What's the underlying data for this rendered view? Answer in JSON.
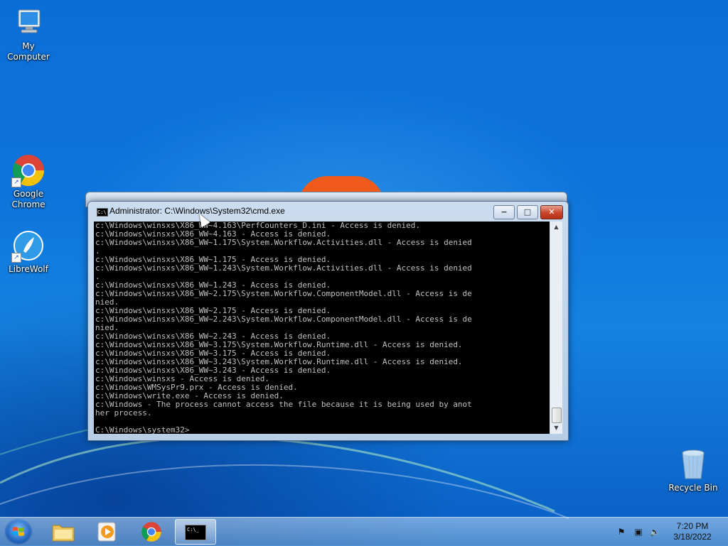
{
  "desktop": {
    "icons": [
      {
        "label": "My Computer"
      },
      {
        "label": "Google\nChrome"
      },
      {
        "label": "LibreWolf"
      },
      {
        "label": "Recycle Bin"
      }
    ]
  },
  "cmd_window": {
    "title": "Administrator: C:\\Windows\\System32\\cmd.exe",
    "buttons": {
      "minimize": "−",
      "maximize": "□",
      "close": "✕"
    },
    "console_lines": [
      "c:\\Windows\\winsxs\\X86_WW~4.163\\PerfCounters_D.ini - Access is denied.",
      "c:\\Windows\\winsxs\\X86_WW~4.163 - Access is denied.",
      "c:\\Windows\\winsxs\\X86_WW~1.175\\System.Workflow.Activities.dll - Access is denied",
      ".",
      "c:\\Windows\\winsxs\\X86_WW~1.175 - Access is denied.",
      "c:\\Windows\\winsxs\\X86_WW~1.243\\System.Workflow.Activities.dll - Access is denied",
      ".",
      "c:\\Windows\\winsxs\\X86_WW~1.243 - Access is denied.",
      "c:\\Windows\\winsxs\\X86_WW~2.175\\System.Workflow.ComponentModel.dll - Access is de",
      "nied.",
      "c:\\Windows\\winsxs\\X86_WW~2.175 - Access is denied.",
      "c:\\Windows\\winsxs\\X86_WW~2.243\\System.Workflow.ComponentModel.dll - Access is de",
      "nied.",
      "c:\\Windows\\winsxs\\X86_WW~2.243 - Access is denied.",
      "c:\\Windows\\winsxs\\X86_WW~3.175\\System.Workflow.Runtime.dll - Access is denied.",
      "c:\\Windows\\winsxs\\X86_WW~3.175 - Access is denied.",
      "c:\\Windows\\winsxs\\X86_WW~3.243\\System.Workflow.Runtime.dll - Access is denied.",
      "c:\\Windows\\winsxs\\X86_WW~3.243 - Access is denied.",
      "c:\\Windows\\winsxs - Access is denied.",
      "c:\\Windows\\WMSysPr9.prx - Access is denied.",
      "c:\\Windows\\write.exe - Access is denied.",
      "c:\\Windows - The process cannot access the file because it is being used by anot",
      "her process.",
      "",
      "C:\\Windows\\system32>"
    ]
  },
  "taskbar": {
    "clock_time": "7:20 PM",
    "clock_date": "3/18/2022",
    "pinned": [
      "windows-explorer",
      "windows-media-player",
      "google-chrome",
      "cmd"
    ],
    "active": "cmd"
  },
  "colors": {
    "desktop_blue": "#0d74db",
    "console_bg": "#000000",
    "console_fg": "#c0c0c0",
    "close_red": "#c7432a"
  }
}
